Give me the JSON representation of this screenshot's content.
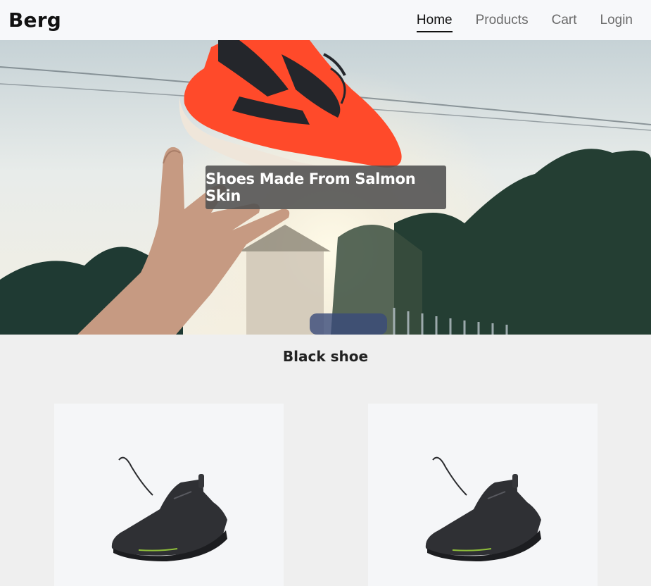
{
  "brand": "Berg",
  "nav": {
    "items": [
      {
        "label": "Home",
        "active": true
      },
      {
        "label": "Products",
        "active": false
      },
      {
        "label": "Cart",
        "active": false
      },
      {
        "label": "Login",
        "active": false
      }
    ]
  },
  "hero": {
    "caption": "Shoes Made From Salmon Skin",
    "image": "red-sneaker-thrown-icon"
  },
  "section": {
    "title": "Black shoe"
  },
  "products": [
    {
      "image": "black-sneaker-icon"
    },
    {
      "image": "black-sneaker-icon"
    }
  ],
  "colors": {
    "navbar_bg": "#f7f8fa",
    "page_bg": "#efefef",
    "caption_bg": "#505050",
    "sneaker_accent": "#ff4a2a"
  }
}
